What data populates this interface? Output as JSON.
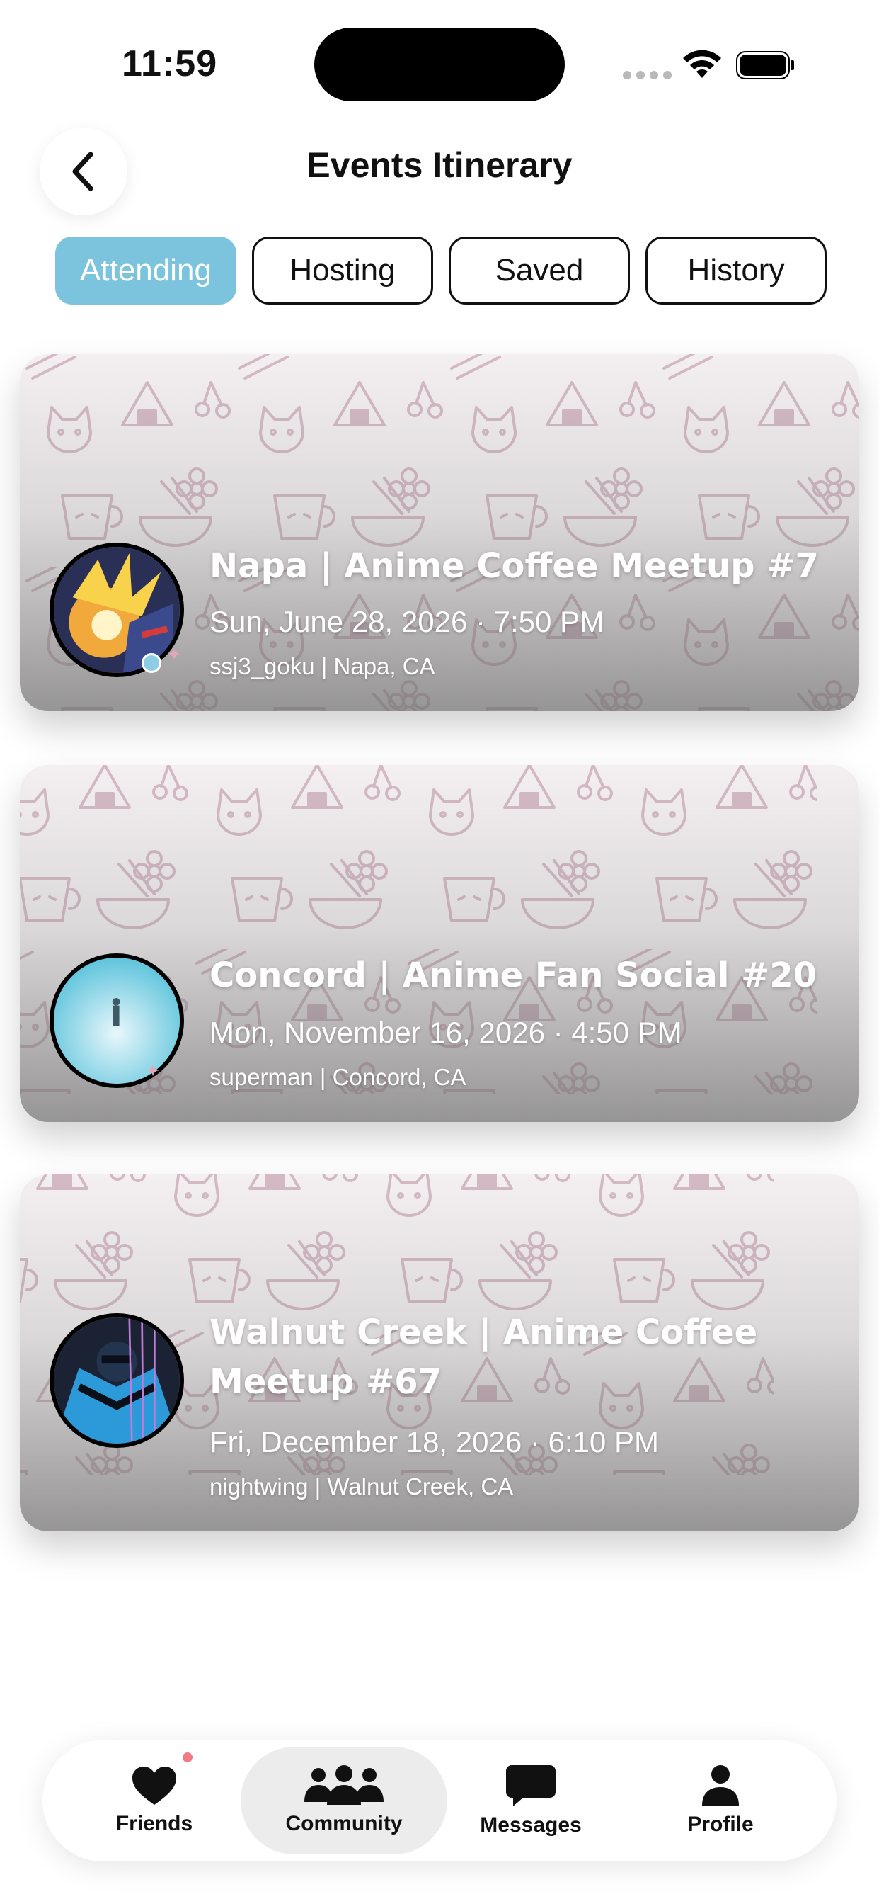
{
  "status_bar": {
    "time": "11:59"
  },
  "header": {
    "title": "Events Itinerary",
    "back_icon": "chevron-left-icon"
  },
  "tabs": [
    {
      "label": "Attending",
      "active": true
    },
    {
      "label": "Hosting",
      "active": false
    },
    {
      "label": "Saved",
      "active": false
    },
    {
      "label": "History",
      "active": false
    }
  ],
  "events": [
    {
      "title": "Napa | Anime Coffee Meetup #7",
      "datetime": "Sun, June 28, 2026 · 7:50 PM",
      "host_location": "ssj3_goku | Napa, CA"
    },
    {
      "title": "Concord | Anime Fan Social #20",
      "datetime": "Mon, November 16, 2026 · 4:50 PM",
      "host_location": "superman | Concord, CA"
    },
    {
      "title": "Walnut Creek | Anime Coffee Meetup #67",
      "datetime": "Fri, December 18, 2026 · 6:10 PM",
      "host_location": "nightwing | Walnut Creek, CA"
    }
  ],
  "bottom_nav": [
    {
      "label": "Friends",
      "icon": "heart-icon",
      "active": false,
      "notification": true
    },
    {
      "label": "Community",
      "icon": "people-icon",
      "active": true
    },
    {
      "label": "Messages",
      "icon": "chat-bubble-icon",
      "active": false
    },
    {
      "label": "Profile",
      "icon": "person-icon",
      "active": false
    }
  ],
  "colors": {
    "active_tab": "#7cc4de",
    "pattern_stroke": "#c9a8b6",
    "notification_dot": "#f07a85"
  }
}
